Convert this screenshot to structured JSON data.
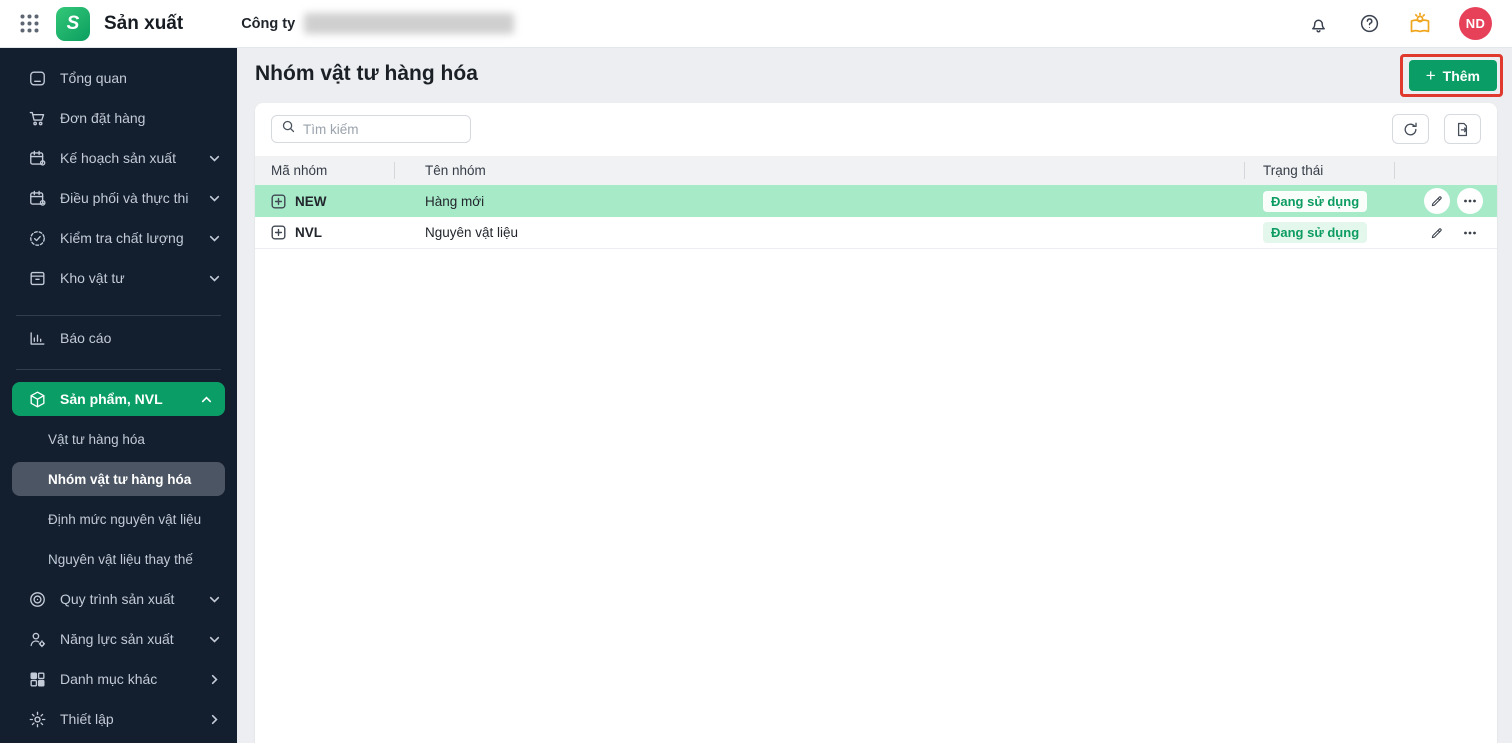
{
  "topbar": {
    "app_title": "Sản xuất",
    "company_label": "Công ty",
    "avatar_initials": "ND",
    "icons": [
      "apps-grid",
      "notification-bell",
      "help",
      "whats-new-tips",
      "avatar"
    ]
  },
  "sidebar": {
    "items": [
      {
        "label": "Tổng quan",
        "icon": "overview"
      },
      {
        "label": "Đơn đặt hàng",
        "icon": "order-cart"
      },
      {
        "label": "Kế hoạch sản xuất",
        "icon": "calendar-gear",
        "chevron": "down"
      },
      {
        "label": "Điều phối và thực thi",
        "icon": "calendar-clock",
        "chevron": "down"
      },
      {
        "label": "Kiểm tra chất lượng",
        "icon": "check-circle",
        "chevron": "down"
      },
      {
        "label": "Kho vật tư",
        "icon": "warehouse-box",
        "chevron": "down"
      },
      {
        "label": "Báo cáo",
        "icon": "report-chart"
      },
      {
        "label": "Sản phẩm, NVL",
        "icon": "cube",
        "chevron": "up",
        "active": true
      },
      {
        "label": "Vật tư hàng hóa",
        "submenu": true
      },
      {
        "label": "Nhóm vật tư hàng hóa",
        "submenu": true,
        "selected": true
      },
      {
        "label": "Định mức nguyên vật liệu",
        "submenu": true
      },
      {
        "label": "Nguyên vật liệu thay thế",
        "submenu": true
      },
      {
        "label": "Quy trình sản xuất",
        "icon": "process-target",
        "chevron": "down"
      },
      {
        "label": "Năng lực sản xuất",
        "icon": "person-gear",
        "chevron": "down"
      },
      {
        "label": "Danh mục khác",
        "icon": "category-grid",
        "chevron": "right"
      },
      {
        "label": "Thiết lập",
        "icon": "settings-gear",
        "chevron": "right"
      }
    ]
  },
  "main": {
    "page_title": "Nhóm vật tư hàng hóa",
    "add_button": {
      "plus": "+",
      "label": "Thêm"
    },
    "search_placeholder": "Tìm kiếm",
    "toolbar_icons": [
      "refresh",
      "export-file"
    ],
    "table": {
      "columns": {
        "code": "Mã nhóm",
        "name": "Tên nhóm",
        "status": "Trạng thái"
      },
      "rows": [
        {
          "code": "NEW",
          "name": "Hàng mới",
          "status": "Đang sử dụng",
          "highlighted": true
        },
        {
          "code": "NVL",
          "name": "Nguyên vật liệu",
          "status": "Đang sử dụng",
          "highlighted": false
        }
      ]
    }
  },
  "colors": {
    "accent_green": "#0a9e66",
    "row_highlight": "#a6eac8",
    "status_text_green": "#0c9c61",
    "annotation_red": "#e0392e",
    "avatar_red": "#e7415a",
    "tips_orange": "#f0a51e",
    "sidebar_bg": "#131e2e",
    "selected_submenu_bg": "#4c5564"
  }
}
